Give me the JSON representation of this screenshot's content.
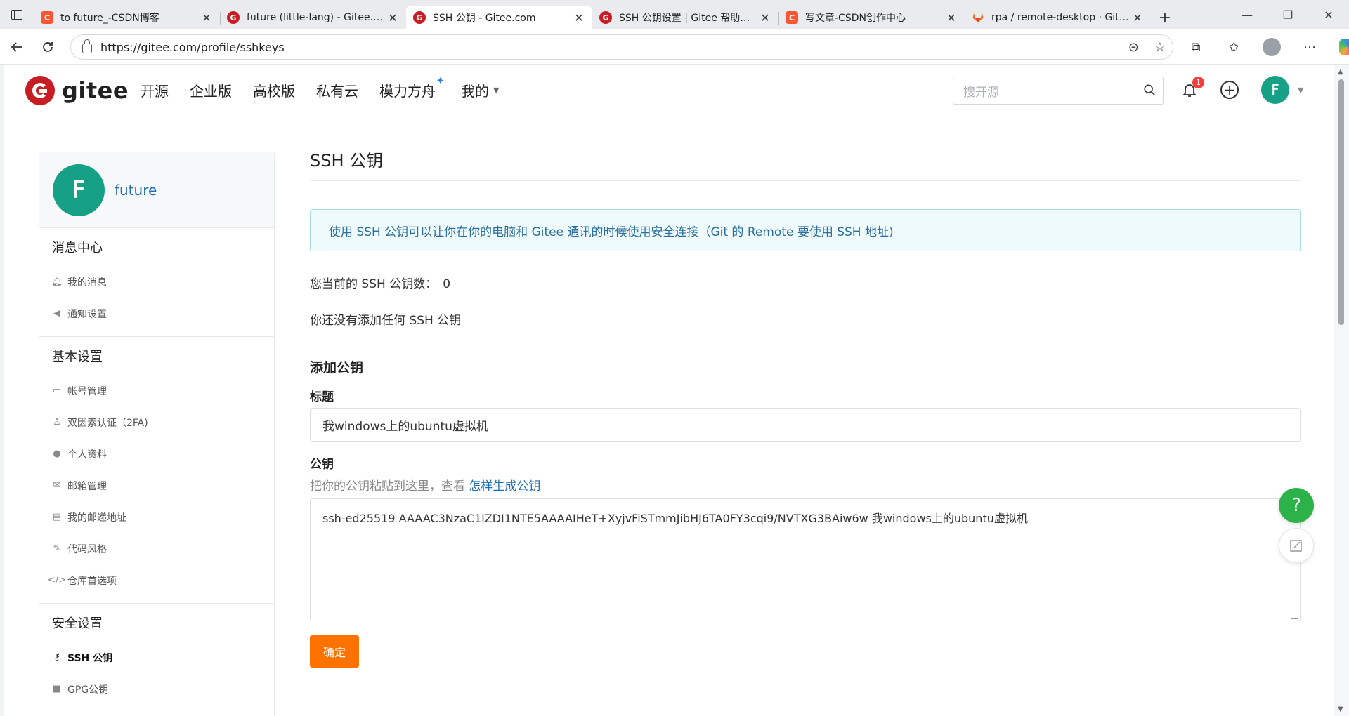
{
  "browser": {
    "tabs": [
      {
        "title": "to future_-CSDN博客",
        "favicon": "csdn",
        "active": false
      },
      {
        "title": "future (little-lang) - Gitee.com",
        "favicon": "gitee",
        "active": false
      },
      {
        "title": "SSH 公钥 - Gitee.com",
        "favicon": "gitee",
        "active": true
      },
      {
        "title": "SSH 公钥设置 | Gitee 帮助中心",
        "favicon": "gitee",
        "active": false
      },
      {
        "title": "写文章-CSDN创作中心",
        "favicon": "csdn",
        "active": false
      },
      {
        "title": "rpa / remote-desktop · GitLab",
        "favicon": "gitlab",
        "active": false
      }
    ],
    "url": "https://gitee.com/profile/sshkeys",
    "tab_close": "✕",
    "new_tab": "+",
    "win_controls": [
      "—",
      "❐",
      "✕"
    ]
  },
  "header": {
    "logo_text": "gitee",
    "nav": [
      "开源",
      "企业版",
      "高校版",
      "私有云",
      "模力方舟",
      "我的"
    ],
    "search_placeholder": "搜开源",
    "notification_count": "1",
    "avatar_letter": "F"
  },
  "sidebar": {
    "avatar_letter": "F",
    "username": "future",
    "sections": [
      {
        "title": "消息中心",
        "items": [
          {
            "label": "我的消息",
            "icon": "bell-icon"
          },
          {
            "label": "通知设置",
            "icon": "volume-icon"
          }
        ]
      },
      {
        "title": "基本设置",
        "items": [
          {
            "label": "帐号管理",
            "icon": "id-card-icon"
          },
          {
            "label": "双因素认证（2FA)",
            "icon": "user-shield-icon"
          },
          {
            "label": "个人资料",
            "icon": "user-icon"
          },
          {
            "label": "邮箱管理",
            "icon": "envelope-icon"
          },
          {
            "label": "我的邮递地址",
            "icon": "address-card-icon"
          },
          {
            "label": "代码风格",
            "icon": "brush-icon"
          },
          {
            "label": "仓库首选项",
            "icon": "code-icon"
          }
        ]
      },
      {
        "title": "安全设置",
        "items": [
          {
            "label": "SSH 公钥",
            "icon": "key-icon"
          },
          {
            "label": "GPG公钥",
            "icon": "lock-icon"
          }
        ]
      }
    ]
  },
  "main": {
    "title": "SSH 公钥",
    "info": "使用 SSH 公钥可以让你在你的电脑和 Gitee 通讯的时候使用安全连接（Git 的 Remote 要使用 SSH 地址)",
    "count_label": "您当前的 SSH 公钥数：",
    "count_value": "0",
    "empty_text": "你还没有添加任何 SSH 公钥",
    "add_title": "添加公钥",
    "title_label": "标题",
    "title_value": "我windows上的ubuntu虚拟机",
    "key_label": "公钥",
    "key_hint": "把你的公钥粘贴到这里，查看 ",
    "key_hint_link": "怎样生成公钥",
    "key_value": "ssh-ed25519 AAAAC3NzaC1lZDI1NTE5AAAAIHeT+XyjvFiSTmmJibHJ6TA0FY3cqi9/NVTXG3BAiw6w 我windows上的ubuntu虚拟机",
    "submit_label": "确定"
  },
  "floating": {
    "help": "?"
  }
}
